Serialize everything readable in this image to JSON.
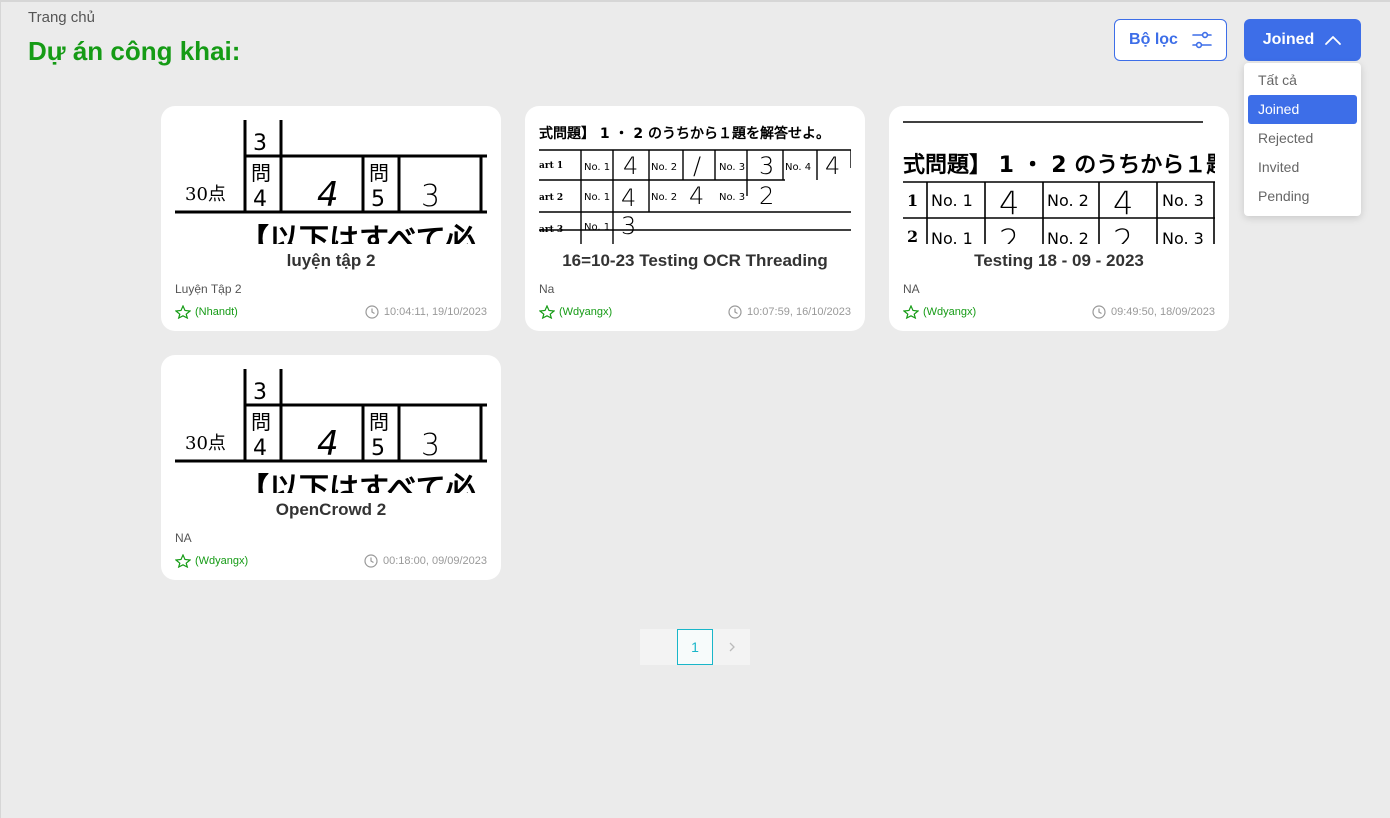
{
  "header": {
    "breadcrumb": "Trang chủ",
    "title": "Dự án công khai:",
    "filter_label": "Bộ lọc",
    "status_label": "Joined"
  },
  "status_dropdown": {
    "options": [
      "Tất cả",
      "Joined",
      "Rejected",
      "Invited",
      "Pending"
    ],
    "selected": "Joined"
  },
  "projects": [
    {
      "title": "luyện tập 2",
      "description": "Luyện Tập 2",
      "owner": "(Nhandt)",
      "time": "10:04:11, 19/10/2023",
      "thumbnail": "answer-sheet-kanji"
    },
    {
      "title": "16=10-23 Testing OCR Threading",
      "description": "Na",
      "owner": "(Wdyangx)",
      "time": "10:07:59, 16/10/2023",
      "thumbnail": "answer-sheet-parts"
    },
    {
      "title": "Testing 18 - 09 - 2023",
      "description": "NA",
      "owner": "(Wdyangx)",
      "time": "09:49:50, 18/09/2023",
      "thumbnail": "answer-sheet-numbers"
    },
    {
      "title": "OpenCrowd 2",
      "description": "NA",
      "owner": "(Wdyangx)",
      "time": "00:18:00, 09/09/2023",
      "thumbnail": "answer-sheet-kanji"
    }
  ],
  "pagination": {
    "current_page": "1",
    "prev_icon": "chevron-left-icon",
    "next_icon": "chevron-right-icon"
  },
  "colors": {
    "accent": "#3d6ee8",
    "title_green": "#159b15",
    "page_active": "#19b6c9",
    "background": "#ebebeb"
  }
}
